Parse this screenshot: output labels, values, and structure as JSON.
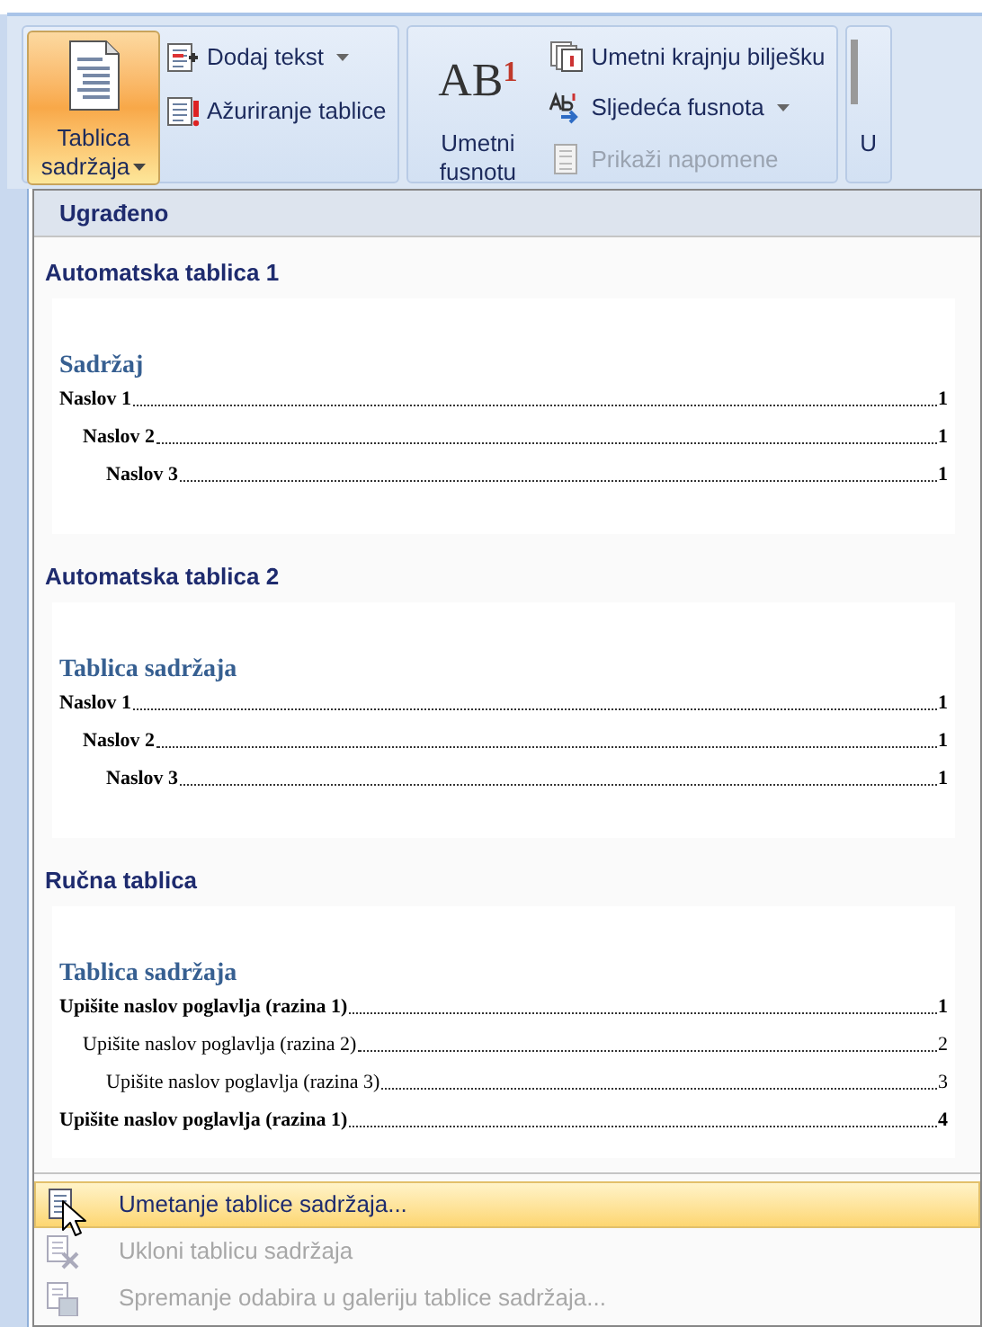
{
  "ribbon": {
    "groups": [
      {
        "large": {
          "label_lines": [
            "Tablica",
            "sadržaja"
          ],
          "has_dropdown": true,
          "selected": true
        },
        "small": [
          {
            "label": "Dodaj tekst",
            "has_dropdown": true,
            "disabled": false
          },
          {
            "label": "Ažuriranje tablice",
            "has_dropdown": false,
            "disabled": false
          }
        ]
      },
      {
        "large": {
          "label_lines": [
            "Umetni",
            "fusnotu"
          ],
          "has_dropdown": false,
          "selected": false,
          "icon_text": "AB",
          "icon_sup": "1"
        },
        "small": [
          {
            "label": "Umetni krajnju bilješku",
            "has_dropdown": false,
            "disabled": false
          },
          {
            "label": "Sljedeća fusnota",
            "has_dropdown": true,
            "disabled": false
          },
          {
            "label": "Prikaži napomene",
            "has_dropdown": false,
            "disabled": true
          }
        ]
      },
      {
        "large": {
          "label_lines": [
            "U"
          ],
          "has_dropdown": false,
          "selected": false
        }
      }
    ]
  },
  "menu": {
    "header": "Ugrađeno",
    "gallery": [
      {
        "heading": "Automatska tablica 1",
        "preview_title": "Sadržaj",
        "entries": [
          {
            "text": "Naslov 1",
            "page": "1",
            "bold": true,
            "children": [
              {
                "text": "Naslov 2",
                "page": "1",
                "bold": true,
                "children": [
                  {
                    "text": "Naslov 3",
                    "page": "1",
                    "bold": true
                  }
                ]
              }
            ]
          }
        ]
      },
      {
        "heading": "Automatska tablica 2",
        "preview_title": "Tablica sadržaja",
        "entries": [
          {
            "text": "Naslov 1",
            "page": "1",
            "bold": true,
            "children": [
              {
                "text": "Naslov 2",
                "page": "1",
                "bold": true,
                "children": [
                  {
                    "text": "Naslov 3",
                    "page": "1",
                    "bold": true
                  }
                ]
              }
            ]
          }
        ]
      },
      {
        "heading": "Ručna tablica",
        "preview_title": "Tablica sadržaja",
        "entries": [
          {
            "text": "Upišite naslov poglavlja (razina 1)",
            "page": "1",
            "bold": true,
            "children": [
              {
                "text": "Upišite naslov poglavlja (razina 2)",
                "page": "2",
                "bold": false,
                "children": [
                  {
                    "text": "Upišite naslov poglavlja (razina 3)",
                    "page": "3",
                    "bold": false
                  }
                ]
              }
            ]
          },
          {
            "text": "Upišite naslov poglavlja (razina 1)",
            "page": "4",
            "bold": true
          }
        ]
      }
    ],
    "commands": [
      {
        "label": "Umetanje tablice sadržaja...",
        "selected": true,
        "disabled": false
      },
      {
        "label": "Ukloni tablicu sadržaja",
        "selected": false,
        "disabled": true
      },
      {
        "label": "Spremanje odabira u galeriju tablice sadržaja...",
        "selected": false,
        "disabled": true
      }
    ]
  }
}
